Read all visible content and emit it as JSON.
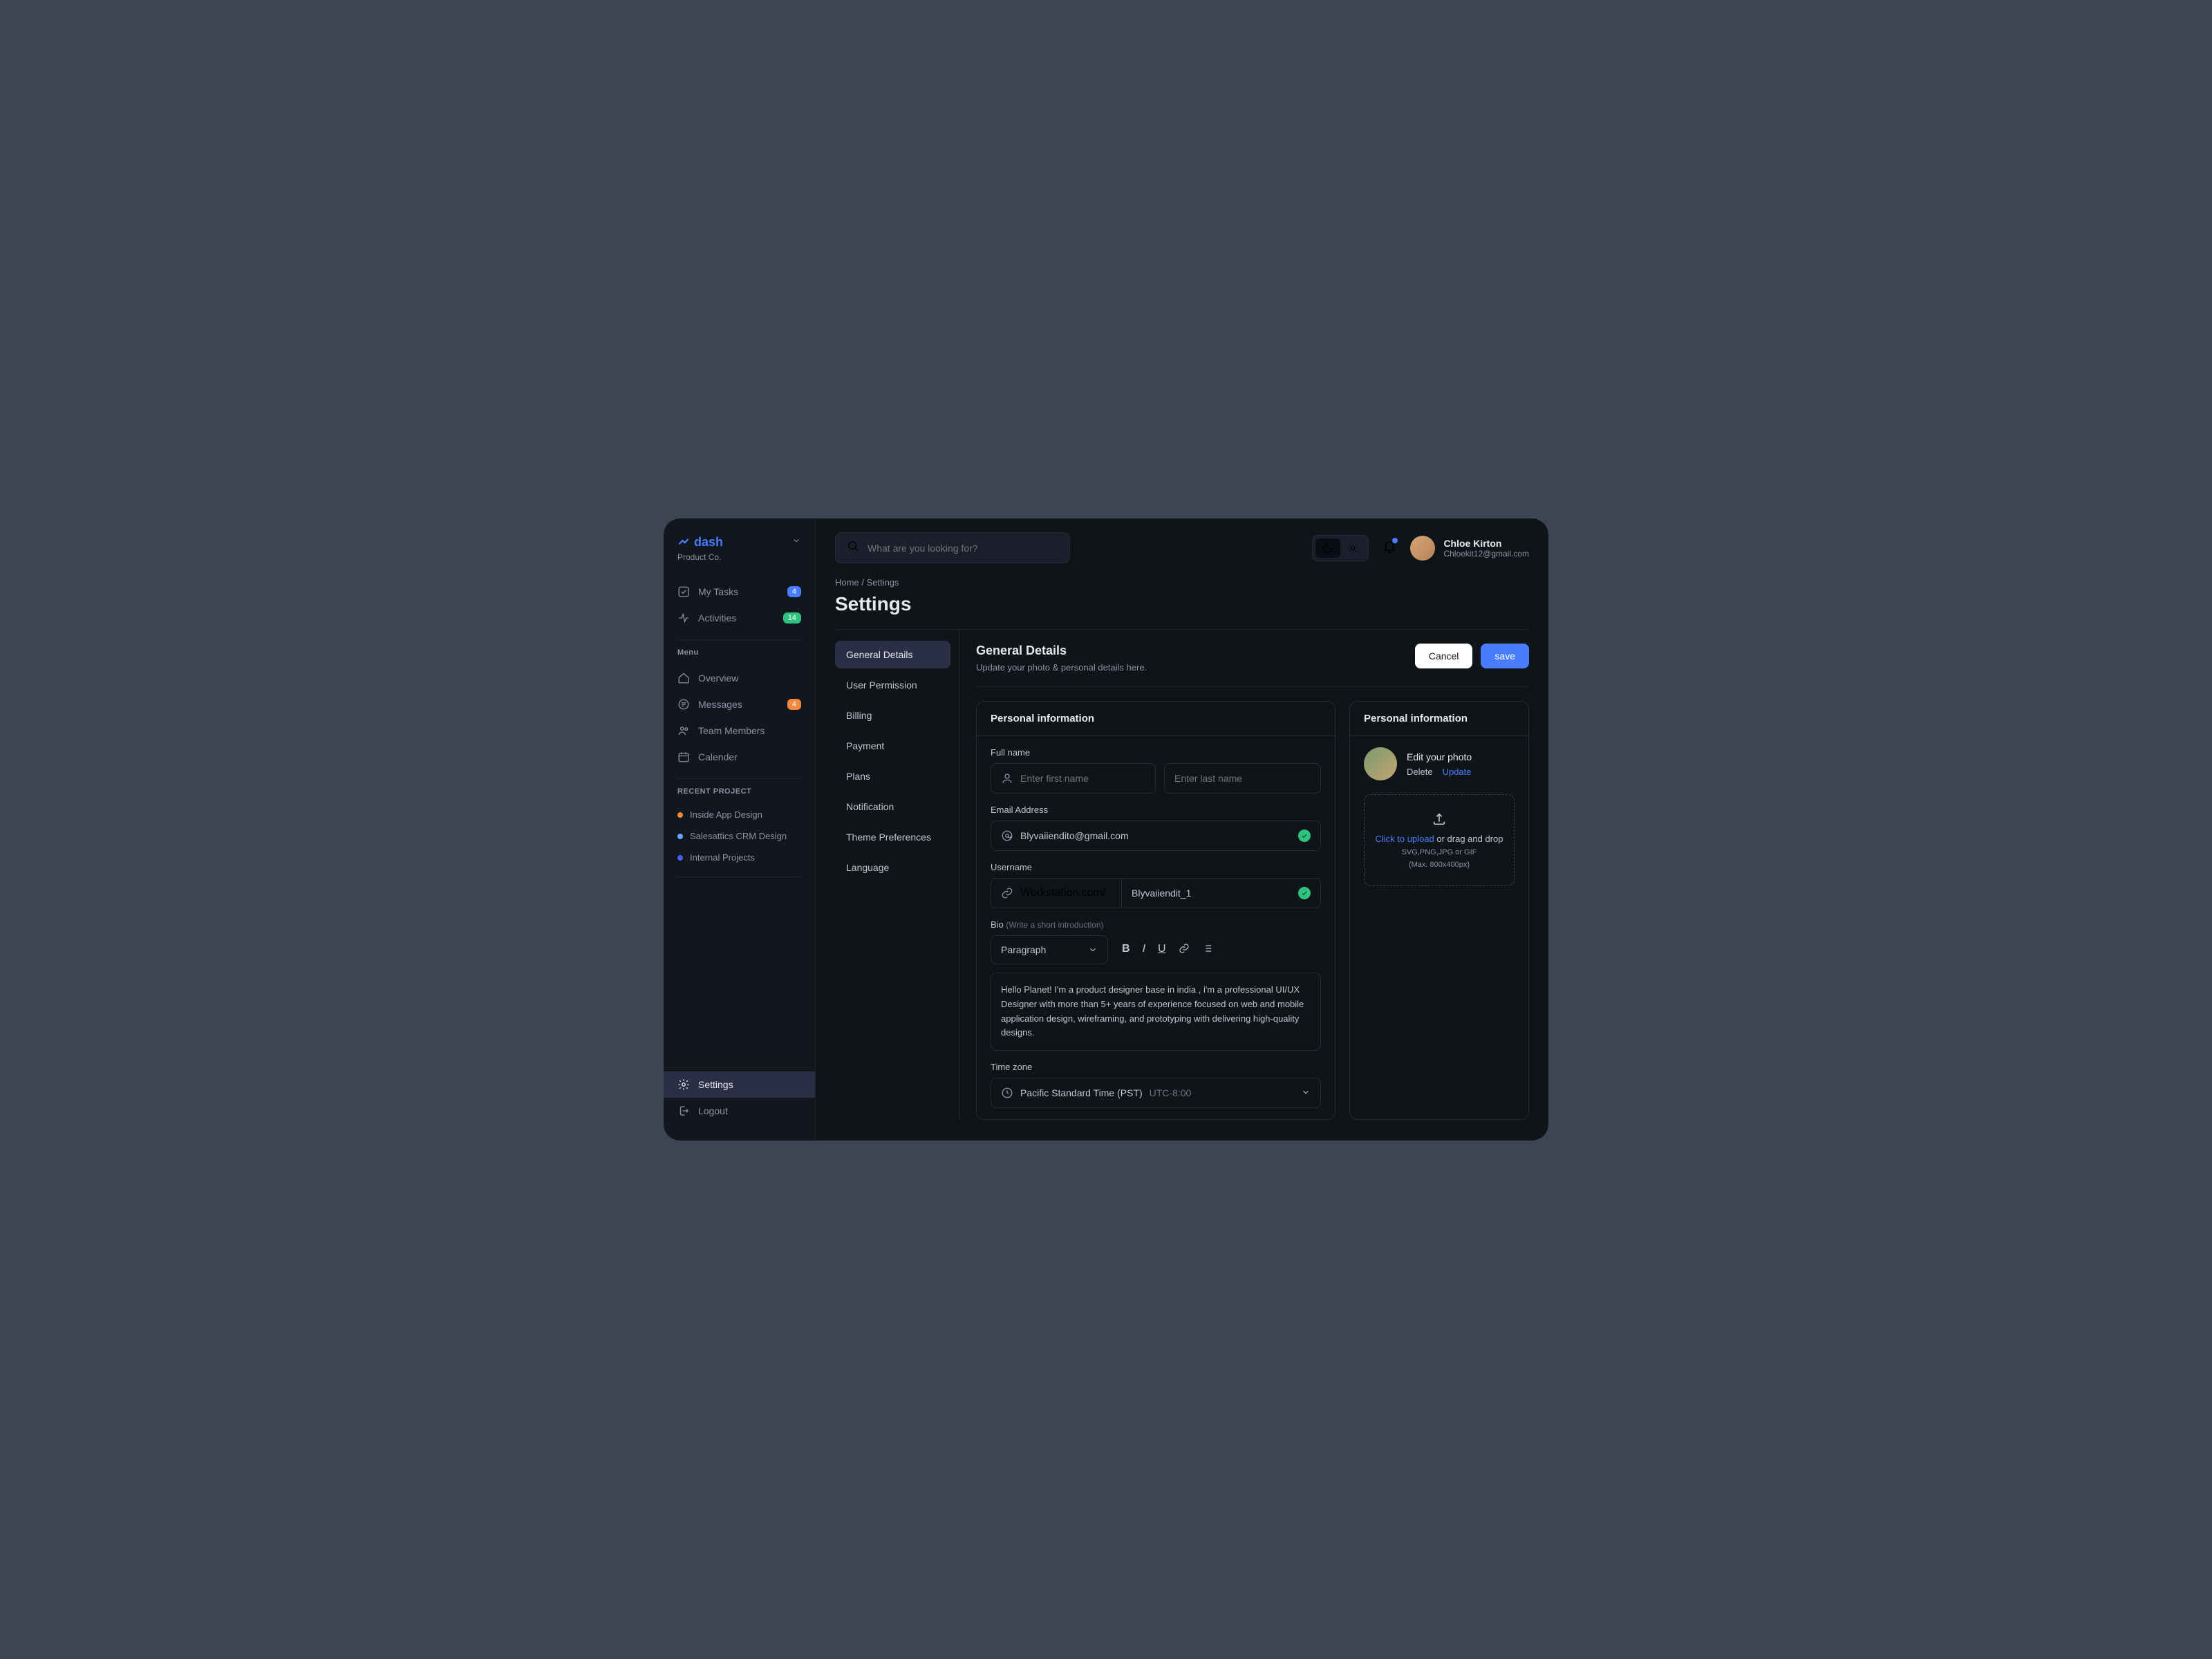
{
  "brand": {
    "name": "dash",
    "subtitle": "Product Co."
  },
  "sidebar": {
    "top": [
      {
        "label": "My Tasks",
        "badge": "4",
        "badgeColor": "blue"
      },
      {
        "label": "Activities",
        "badge": "14",
        "badgeColor": "green"
      }
    ],
    "menuHeading": "Menu",
    "menu": [
      {
        "label": "Overview"
      },
      {
        "label": "Messages",
        "badge": "4",
        "badgeColor": "orange"
      },
      {
        "label": "Team Members"
      },
      {
        "label": "Calender"
      }
    ],
    "projectsHeading": "RECENT PROJECT",
    "projects": [
      {
        "label": "Inside App Design",
        "color": "orange"
      },
      {
        "label": "Salesattics CRM Design",
        "color": "lblue"
      },
      {
        "label": "Internal Projects",
        "color": "dblue"
      }
    ],
    "bottom": [
      {
        "label": "Settings",
        "active": true
      },
      {
        "label": "Logout"
      }
    ]
  },
  "search": {
    "placeholder": "What are you looking for?"
  },
  "user": {
    "name": "Chloe Kirton",
    "email": "Chloekit12@gmail.com"
  },
  "breadcrumb": {
    "home": "Home",
    "sep": "/",
    "current": "Settings"
  },
  "pageTitle": "Settings",
  "tabs": [
    "General Details",
    "User Permission",
    "Billing",
    "Payment",
    "Plans",
    "Notification",
    "Theme Preferences",
    "Language"
  ],
  "panel": {
    "title": "General Details",
    "subtitle": "Update your photo & personal details here.",
    "cancel": "Cancel",
    "save": "save"
  },
  "personal": {
    "heading": "Personal information",
    "fullNameLabel": "Full name",
    "firstNamePlaceholder": "Enter first name",
    "lastNamePlaceholder": "Enter last name",
    "emailLabel": "Email Address",
    "emailValue": "Blyvaiiendito@gmail.com",
    "usernameLabel": "Username",
    "usernamePrefix": "Workstation.com/",
    "usernameValue": "Blyvaiiendit_1",
    "bioLabel": "Bio",
    "bioHint": "(Write a short introduction)",
    "paragraph": "Paragraph",
    "bioText": "Hello Planet! I'm a product designer base in india , i'm a professional UI/UX Designer with more than 5+ years of experience focused on web and mobile application design, wireframing, and prototyping with delivering high-quality designs.",
    "tzLabel": "Time zone",
    "tzValue": "Pacific Standard Time (PST)",
    "tzOffset": "UTC-8:00"
  },
  "photoCard": {
    "heading": "Personal information",
    "editTitle": "Edit your photo",
    "delete": "Delete",
    "update": "Update",
    "click": "Click to upload",
    "drag": " or drag and drop",
    "formats": "SVG,PNG,JPG or GIF",
    "max": "(Max. 800x400px)"
  }
}
